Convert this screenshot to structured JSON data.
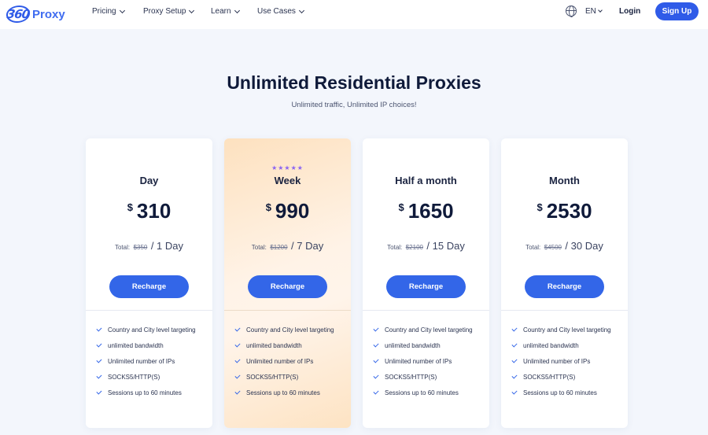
{
  "header": {
    "logo_mark": "360",
    "logo_word": "Proxy",
    "nav": [
      "Pricing",
      "Proxy Setup",
      "Learn",
      "Use Cases"
    ],
    "language": "EN",
    "login": "Login",
    "signup": "Sign Up"
  },
  "hero": {
    "title": "Unlimited Residential Proxies",
    "subtitle": "Unlimited traffic, Unlimited IP choices!"
  },
  "plans": [
    {
      "name": "Day",
      "currency": "$",
      "price": "310",
      "total_label": "Total:",
      "old_price": "$350",
      "duration": "1 Day",
      "button": "Recharge",
      "highlighted": false,
      "stars": ""
    },
    {
      "name": "Week",
      "currency": "$",
      "price": "990",
      "total_label": "Total:",
      "old_price": "$1200",
      "duration": "7 Day",
      "button": "Recharge",
      "highlighted": true,
      "stars": "★★★★★"
    },
    {
      "name": "Half a month",
      "currency": "$",
      "price": "1650",
      "total_label": "Total:",
      "old_price": "$2100",
      "duration": "15 Day",
      "button": "Recharge",
      "highlighted": false,
      "stars": ""
    },
    {
      "name": "Month",
      "currency": "$",
      "price": "2530",
      "total_label": "Total:",
      "old_price": "$4500",
      "duration": "30 Day",
      "button": "Recharge",
      "highlighted": false,
      "stars": ""
    }
  ],
  "features": [
    "Country and City level targeting",
    "unlimited bandwidth",
    "Unlimited number of IPs",
    "SOCKS5/HTTP(S)",
    "Sessions up to 60 minutes"
  ],
  "colors": {
    "accent": "#2f5be8",
    "button": "#3366e8",
    "stars": "#8a63f2",
    "page_bg": "#f3f6fc",
    "highlight_card": "#fde1bf"
  },
  "icons": [
    "globe-icon",
    "chevron-down-icon",
    "check-icon",
    "star-icon"
  ]
}
